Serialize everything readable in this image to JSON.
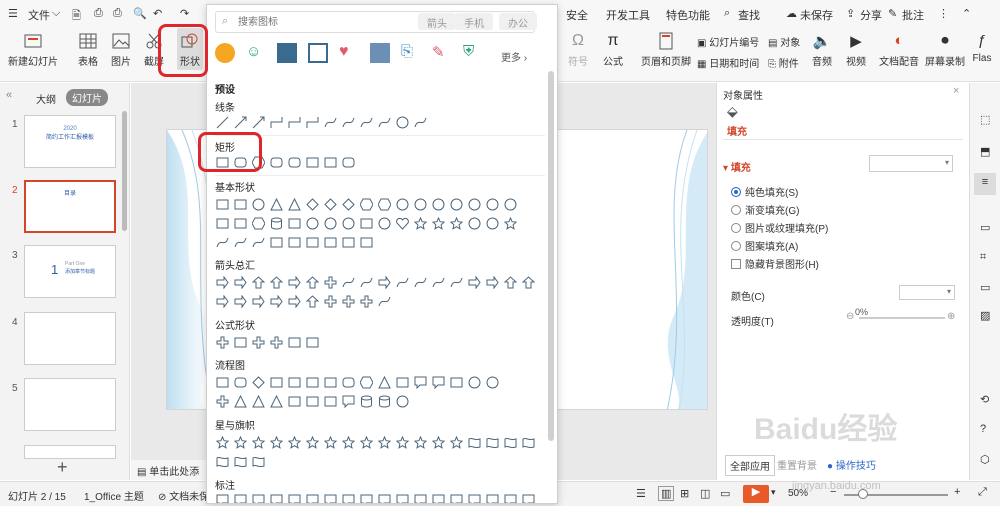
{
  "menu": {
    "file": "文件",
    "security": "安全",
    "devtools": "开发工具",
    "special": "特色功能",
    "search": "查找",
    "unsaved": "未保存",
    "share": "分享",
    "comment": "批注"
  },
  "ribbon": {
    "new_slide": "新建幻灯片",
    "table": "表格",
    "picture": "图片",
    "screenshot": "截屏",
    "shapes": "形状",
    "symbol": "符号",
    "formula": "公式",
    "header_footer": "页眉和页脚",
    "slide_number": "幻灯片编号",
    "object": "对象",
    "date_time": "日期和时间",
    "attachment": "附件",
    "audio": "音频",
    "video": "视频",
    "doc_voice": "文档配音",
    "screen_record": "屏幕录制",
    "flash": "Flas"
  },
  "dropdown": {
    "search_placeholder": "搜索图标",
    "tags": [
      "箭头",
      "手机",
      "办公"
    ],
    "more": "更多",
    "presets": "预设",
    "lines": "线条",
    "rectangles": "矩形",
    "basic": "基本形状",
    "arrows": "箭头总汇",
    "formula": "公式形状",
    "flowchart": "流程图",
    "stars": "星与旗帜",
    "callouts": "标注"
  },
  "leftpanel": {
    "outline": "大纲",
    "slides": "幻灯片",
    "slide_nums": [
      "1",
      "2",
      "3",
      "4",
      "5"
    ],
    "t1_year": "2020",
    "t1_title": "简约工作汇报模板",
    "t2_title": "目录",
    "t3_num": "1",
    "t3_part": "Part One",
    "t3_title": "添加章节标题"
  },
  "canvas": {
    "notes": "单击此处添加"
  },
  "rightpanel": {
    "title": "对象属性",
    "tab": "填充",
    "section": "填充",
    "fill_options": [
      "纯色填充(S)",
      "渐变填充(G)",
      "图片或纹理填充(P)",
      "图案填充(A)"
    ],
    "hide_bg": "隐藏背景图形(H)",
    "color": "颜色(C)",
    "transparency": "透明度(T)",
    "transparency_value": "0%",
    "apply_all": "全部应用",
    "reset": "重置背景",
    "tip": "操作技巧"
  },
  "status": {
    "slide_info": "幻灯片 2 / 15",
    "theme": "1_Office 主题",
    "doc": "文档未保",
    "zoom": "50%"
  },
  "watermark": {
    "brand": "Baidu经验",
    "url": "jingyan.baidu.com"
  },
  "colors": {
    "accent": "#d24726",
    "highlight": "#e0262d",
    "blue": "#2b66c8"
  }
}
